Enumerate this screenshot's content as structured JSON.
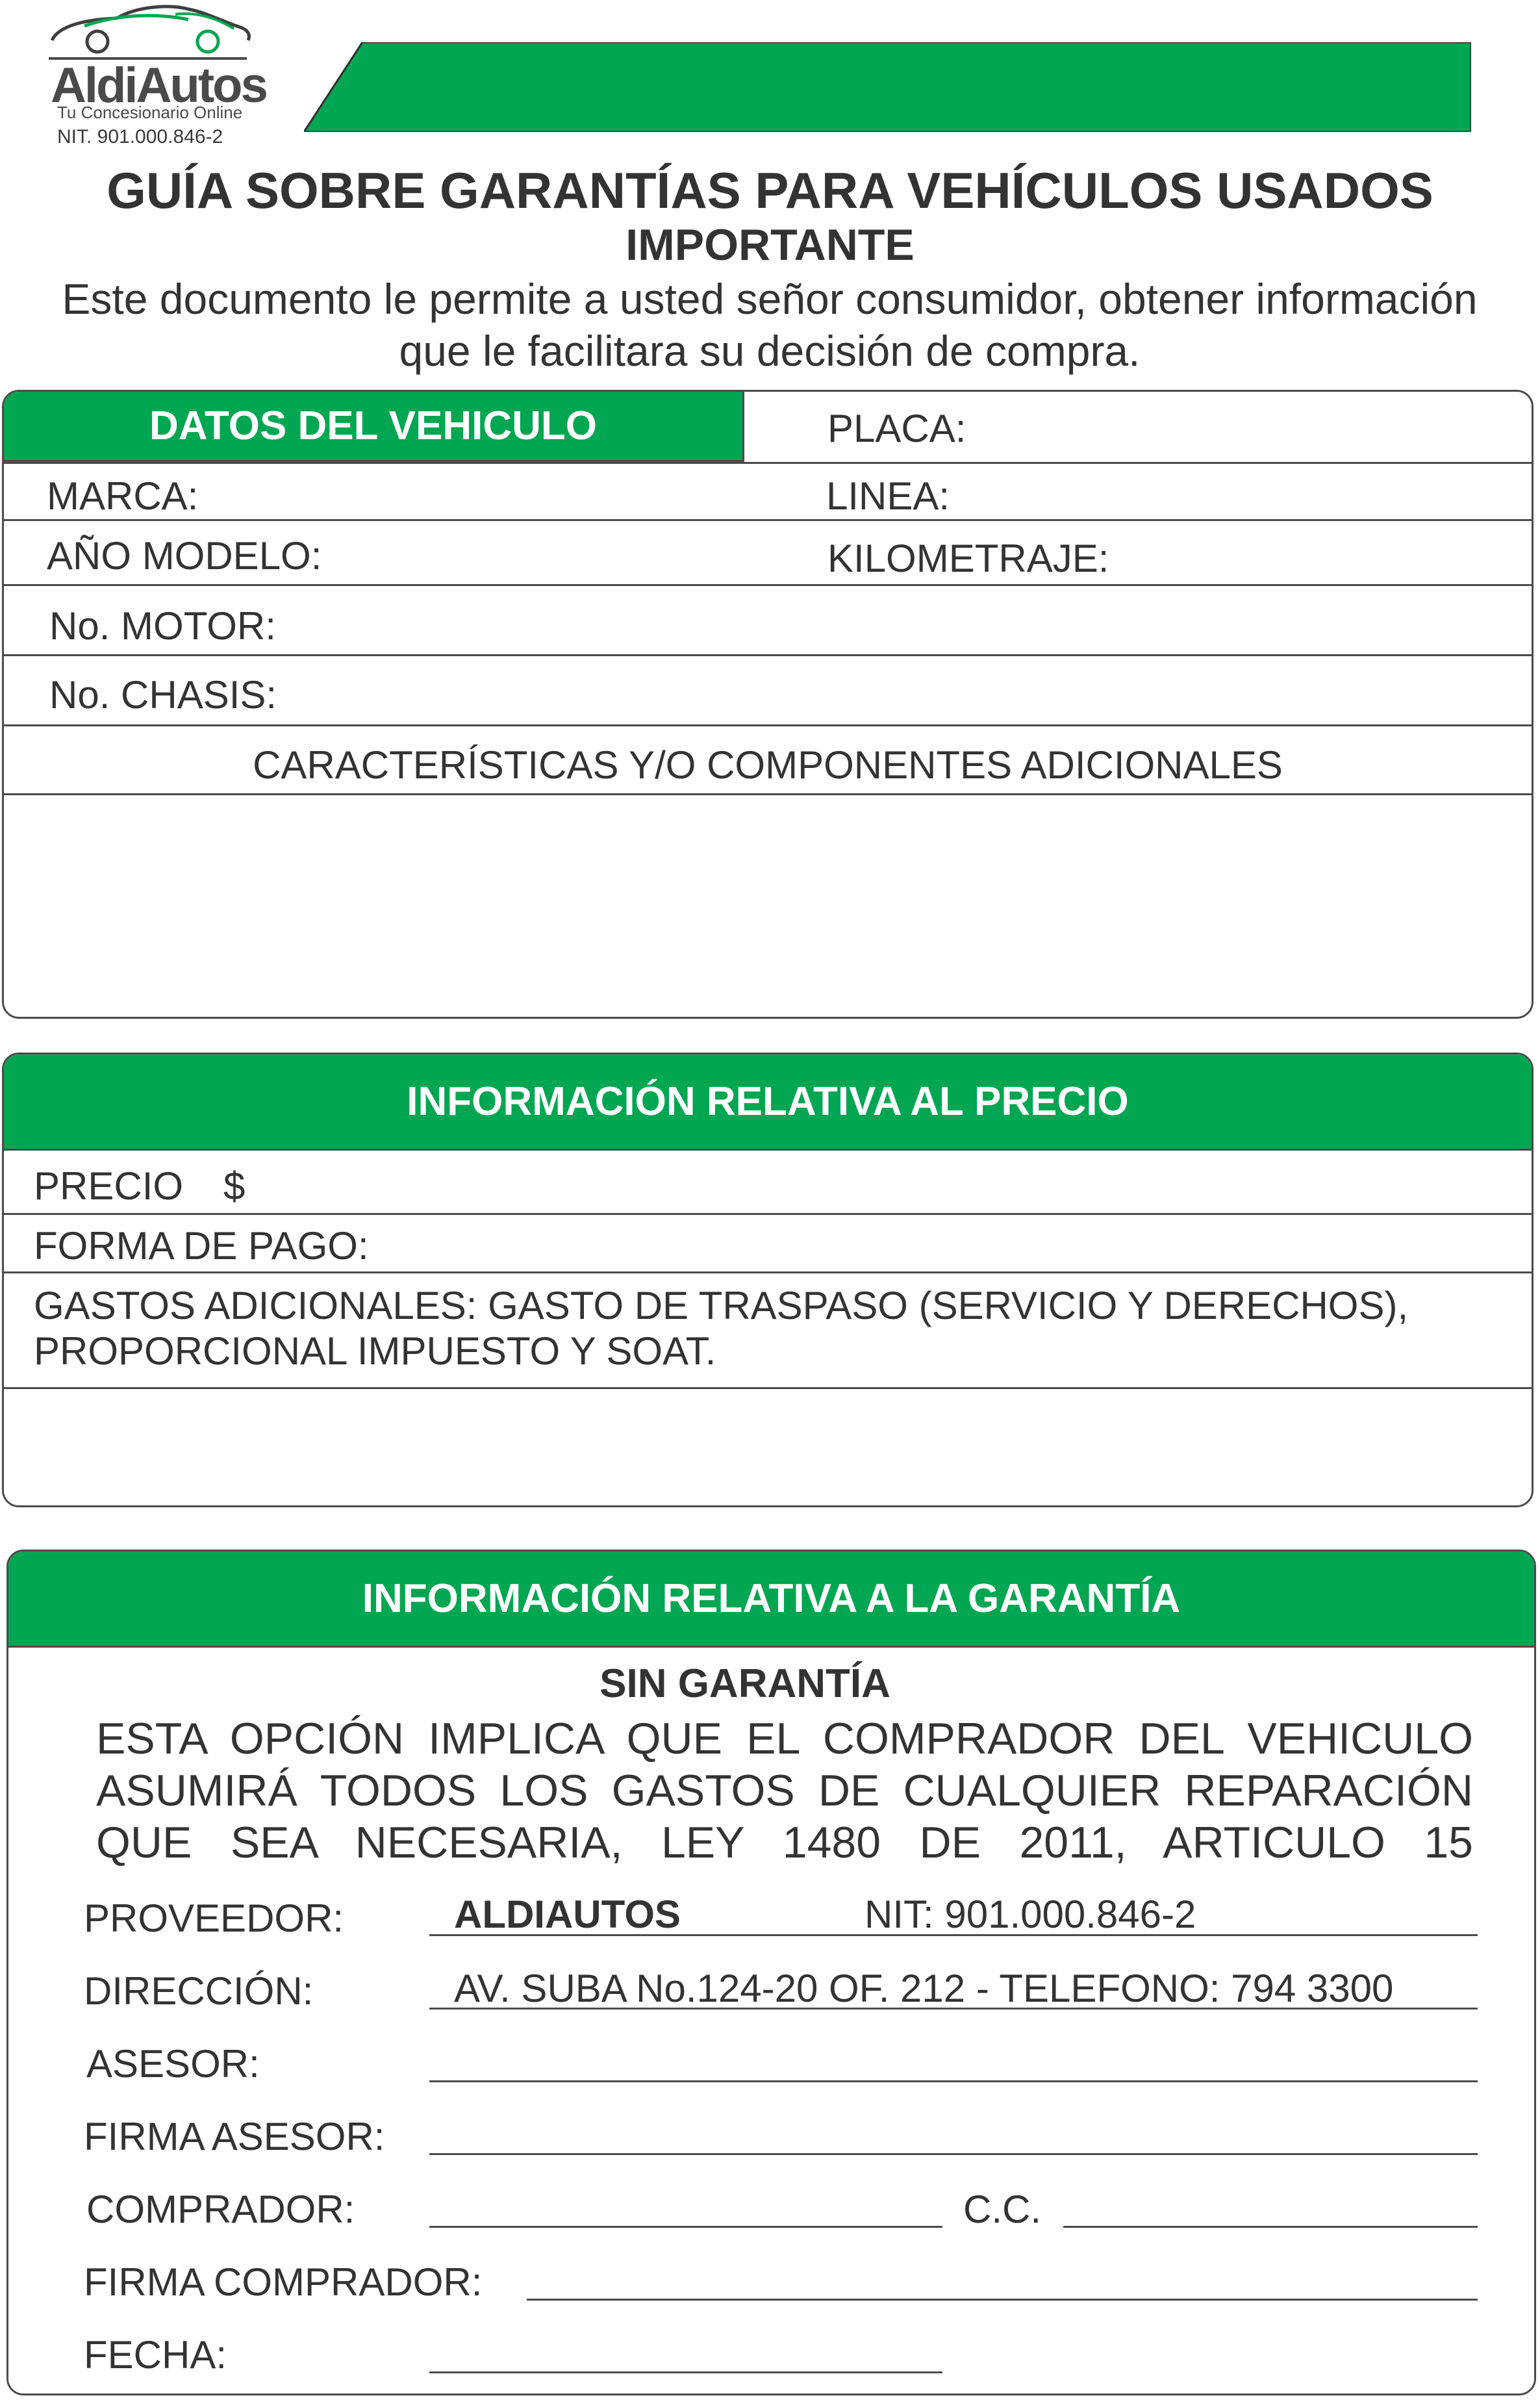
{
  "brand": {
    "name": "AldiAutos",
    "tagline": "Tu Concesionario Online",
    "nit": "NIT. 901.000.846-2",
    "accent_color": "#00a651"
  },
  "header": {
    "title": "GUÍA SOBRE GARANTÍAS PARA VEHÍCULOS USADOS",
    "subtitle": "IMPORTANTE",
    "intro_line1": "Este documento le permite a usted señor consumidor, obtener información",
    "intro_line2": "que le facilitara su decisión de compra."
  },
  "vehicle": {
    "heading": "DATOS DEL VEHICULO",
    "placa": "PLACA:",
    "marca": "MARCA:",
    "linea": "LINEA:",
    "anio_modelo": "AÑO MODELO:",
    "kilometraje": "KILOMETRAJE:",
    "motor": "No. MOTOR:",
    "chasis": "No. CHASIS:",
    "caracteristicas": "CARACTERÍSTICAS Y/O COMPONENTES ADICIONALES"
  },
  "price": {
    "heading": "INFORMACIÓN RELATIVA AL PRECIO",
    "precio": "PRECIO",
    "currency": "$",
    "forma_pago": "FORMA DE PAGO:",
    "gastos_line1": "GASTOS ADICIONALES: GASTO DE TRASPASO (SERVICIO Y DERECHOS),",
    "gastos_line2": "PROPORCIONAL IMPUESTO Y SOAT."
  },
  "warranty": {
    "heading": "INFORMACIÓN RELATIVA A LA GARANTÍA",
    "option": "SIN GARANTÍA",
    "notice_line1": "ESTA OPCIÓN IMPLICA QUE EL COMPRADOR DEL VEHICULO",
    "notice_line2": "ASUMIRÁ TODOS LOS GASTOS DE CUALQUIER REPARACIÓN",
    "notice_line3": "QUE SEA NECESARIA, LEY 1480 DE 2011, ARTICULO 15",
    "proveedor_label": "PROVEEDOR:",
    "proveedor_value": "ALDIAUTOS",
    "proveedor_nit": "NIT: 901.000.846-2",
    "direccion_label": "DIRECCIÓN:",
    "direccion_value": "AV. SUBA No.124-20 OF. 212 - TELEFONO: 794 3300",
    "asesor_label": "ASESOR:",
    "firma_asesor_label": "FIRMA ASESOR:",
    "comprador_label": "COMPRADOR:",
    "cc_label": "C.C.",
    "firma_comprador_label": "FIRMA COMPRADOR:",
    "fecha_label": "FECHA:"
  }
}
